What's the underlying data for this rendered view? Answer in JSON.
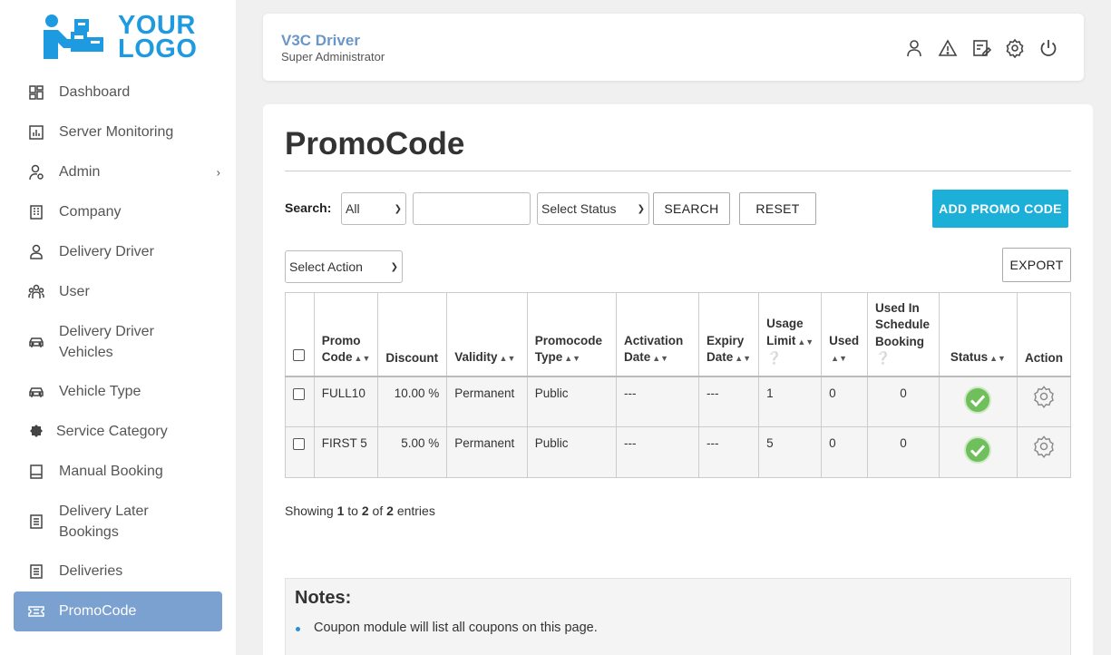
{
  "logo": {
    "line1": "YOUR",
    "line2": "LOGO",
    "color": "#1e9be0"
  },
  "sidebar": {
    "items": [
      {
        "label": "Dashboard",
        "icon": "dashboard-icon"
      },
      {
        "label": "Server Monitoring",
        "icon": "chart-icon"
      },
      {
        "label": "Admin",
        "icon": "admin-user-icon",
        "has_submenu": true
      },
      {
        "label": "Company",
        "icon": "building-icon"
      },
      {
        "label": "Delivery Driver",
        "icon": "driver-icon"
      },
      {
        "label": "User",
        "icon": "users-icon"
      },
      {
        "label": "Delivery Driver Vehicles",
        "icon": "car-icon"
      },
      {
        "label": "Vehicle Type",
        "icon": "car-icon"
      },
      {
        "label": "Service Category",
        "icon": "gear-badge-icon"
      },
      {
        "label": "Manual Booking",
        "icon": "booking-icon"
      },
      {
        "label": "Delivery Later Bookings",
        "icon": "list-icon"
      },
      {
        "label": "Deliveries",
        "icon": "list-icon"
      },
      {
        "label": "PromoCode",
        "icon": "ticket-icon",
        "active": true
      }
    ],
    "submenu_glyph": "›",
    "active_color": "#7ba1d0"
  },
  "header": {
    "title": "V3C Driver",
    "subtitle": "Super Administrator",
    "icons": [
      "profile-icon",
      "warning-icon",
      "edit-note-icon",
      "settings-icon",
      "power-icon"
    ]
  },
  "page": {
    "title": "PromoCode"
  },
  "search": {
    "label": "Search:",
    "field_select": "All",
    "text_value": "",
    "status_select": "Select Status",
    "search_button": "SEARCH",
    "reset_button": "RESET",
    "add_button": "ADD PROMO CODE",
    "add_button_color": "#1cb0d9"
  },
  "actions": {
    "select_action": "Select Action",
    "export_button": "EXPORT"
  },
  "table": {
    "headers": {
      "promo_code": [
        "Promo",
        "Code"
      ],
      "discount": "Discount",
      "validity": "Validity",
      "promocode_type": [
        "Promocode",
        "Type"
      ],
      "activation_date": [
        "Activation",
        "Date"
      ],
      "expiry_date": [
        "Expiry",
        "Date"
      ],
      "usage_limit": [
        "Usage",
        "Limit"
      ],
      "used": "Used",
      "used_in_schedule_booking": [
        "Used In",
        "Schedule",
        "Booking"
      ],
      "status": "Status",
      "action": "Action"
    },
    "rows": [
      {
        "promo_code": "FULL10",
        "discount": "10.00 %",
        "validity": "Permanent",
        "type": "Public",
        "activation": "---",
        "expiry": "---",
        "usage_limit": "1",
        "used": "0",
        "used_schedule": "0",
        "status": "active"
      },
      {
        "promo_code": "FIRST 5",
        "discount": "5.00 %",
        "validity": "Permanent",
        "type": "Public",
        "activation": "---",
        "expiry": "---",
        "usage_limit": "5",
        "used": "0",
        "used_schedule": "0",
        "status": "active"
      }
    ],
    "status_color": "#6fc05c"
  },
  "pagination": {
    "showing": "Showing",
    "from": "1",
    "to_word": "to",
    "to": "2",
    "of_word": "of",
    "total": "2",
    "entries": "entries"
  },
  "notes": {
    "title": "Notes:",
    "items": [
      "Coupon module will list all coupons on this page."
    ]
  }
}
